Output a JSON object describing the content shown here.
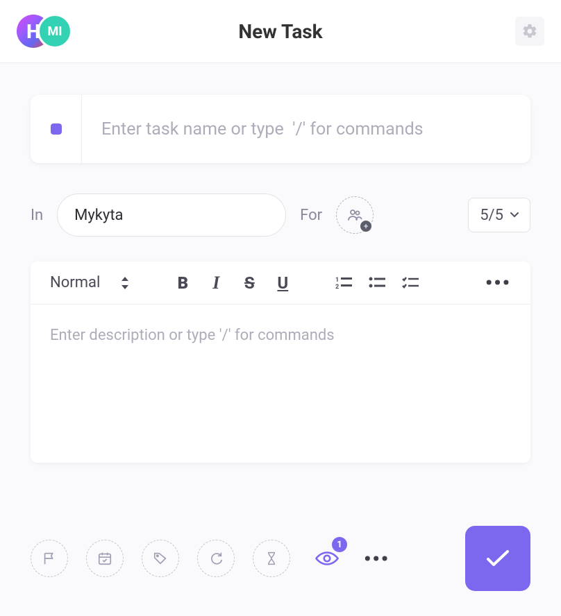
{
  "header": {
    "title": "New Task",
    "avatar1_letter": "H",
    "avatar2_letter": "MI"
  },
  "task": {
    "name_placeholder": "Enter task name or type  '/' for commands"
  },
  "meta": {
    "in_label": "In",
    "in_value": "Mykyta",
    "for_label": "For",
    "counter": "5/5"
  },
  "editor": {
    "format_label": "Normal",
    "description_placeholder": "Enter description or type '/' for commands"
  },
  "watchers": {
    "count": "1"
  }
}
